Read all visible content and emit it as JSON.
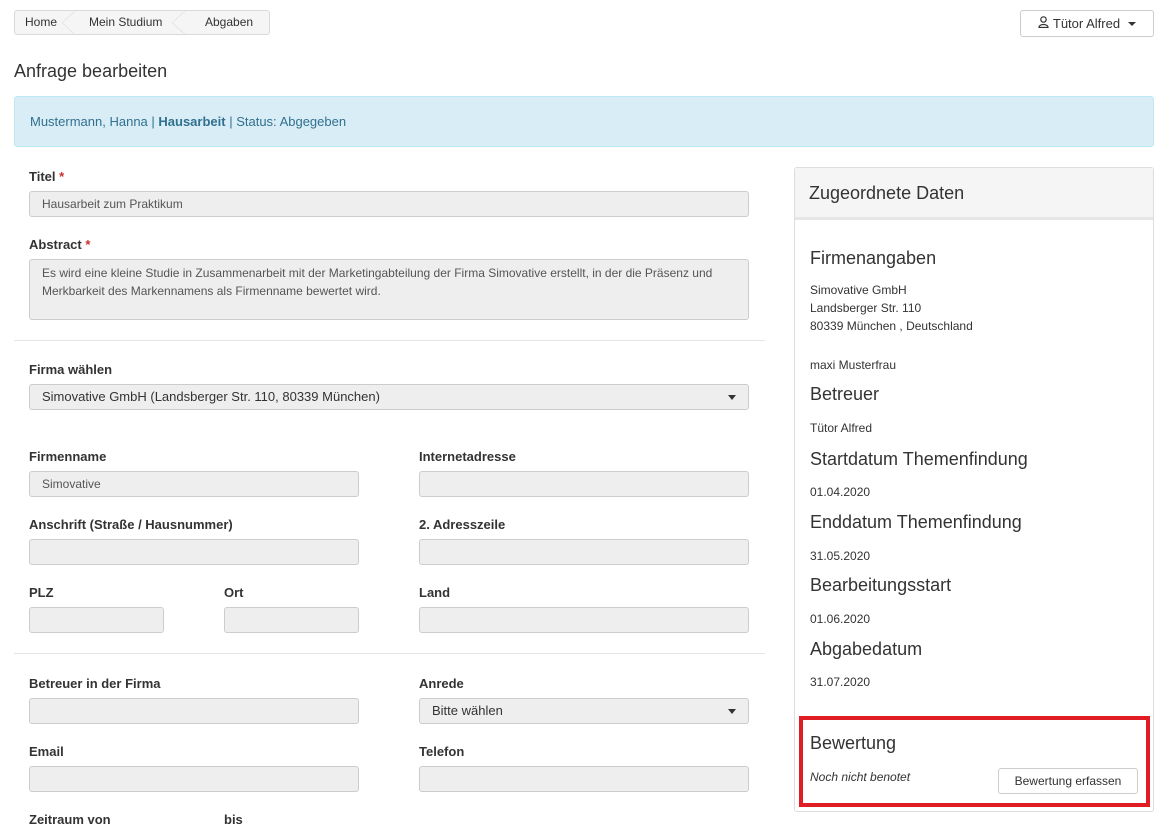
{
  "breadcrumb": [
    "Home",
    "Mein Studium",
    "Abgaben"
  ],
  "user_menu": {
    "icon": "user-icon",
    "label": "Tütor Alfred"
  },
  "page_title": "Anfrage bearbeiten",
  "info_bar": {
    "name": "Mustermann, Hanna",
    "sep1": " | ",
    "type": "Hausarbeit",
    "sep2": " | ",
    "status": "Status: Abgegeben"
  },
  "form": {
    "titel": {
      "label": "Titel",
      "required": "*",
      "value": "Hausarbeit zum Praktikum"
    },
    "abstract": {
      "label": "Abstract",
      "required": "*",
      "value": "Es wird eine kleine Studie in Zusammenarbeit mit der Marketingabteilung der Firma Simovative erstellt, in der die Präsenz und Merkbarkeit des Markennamens als Firmenname bewertet wird."
    },
    "firma_waehlen": {
      "label": "Firma wählen",
      "value": "Simovative GmbH (Landsberger Str. 110, 80339 München)"
    },
    "firmenname": {
      "label": "Firmenname",
      "value": "Simovative"
    },
    "internetadresse": {
      "label": "Internetadresse",
      "value": ""
    },
    "anschrift": {
      "label": "Anschrift (Straße / Hausnummer)",
      "value": ""
    },
    "adresszeile2": {
      "label": "2. Adresszeile",
      "value": ""
    },
    "plz": {
      "label": "PLZ",
      "value": ""
    },
    "ort": {
      "label": "Ort",
      "value": ""
    },
    "land": {
      "label": "Land",
      "value": ""
    },
    "betreuer_firma": {
      "label": "Betreuer in der Firma",
      "value": ""
    },
    "anrede": {
      "label": "Anrede",
      "value": "Bitte wählen"
    },
    "email": {
      "label": "Email",
      "value": ""
    },
    "telefon": {
      "label": "Telefon",
      "value": ""
    },
    "zeitraum_von": {
      "label": "Zeitraum von"
    },
    "bis": {
      "label": "bis"
    }
  },
  "panel": {
    "title": "Zugeordnete Daten",
    "firmenangaben": {
      "heading": "Firmenangaben",
      "line1": "Simovative GmbH",
      "line2": "Landsberger Str. 110",
      "line3": "80339 München , Deutschland",
      "contact": "maxi Musterfrau"
    },
    "betreuer": {
      "heading": "Betreuer",
      "value": "Tütor Alfred"
    },
    "startdatum": {
      "heading": "Startdatum Themenfindung",
      "value": "01.04.2020"
    },
    "enddatum": {
      "heading": "Enddatum Themenfindung",
      "value": "31.05.2020"
    },
    "bearbeitungsstart": {
      "heading": "Bearbeitungsstart",
      "value": "01.06.2020"
    },
    "abgabedatum": {
      "heading": "Abgabedatum",
      "value": "31.07.2020"
    },
    "bewertung": {
      "heading": "Bewertung",
      "status": "Noch nicht benotet",
      "button": "Bewertung erfassen"
    }
  },
  "colors": {
    "info_bg": "#d9edf7",
    "info_text": "#31708f",
    "highlight": "#e01c24",
    "required": "#c9302c"
  }
}
